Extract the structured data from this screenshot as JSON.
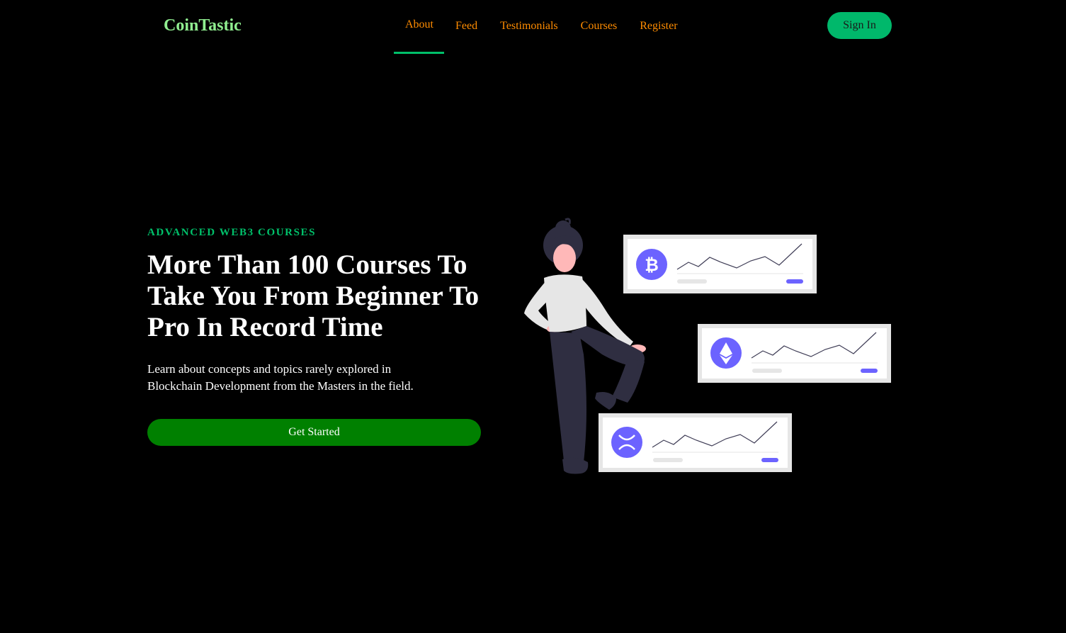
{
  "header": {
    "brand": "CoinTastic",
    "nav": [
      {
        "label": "About",
        "active": true
      },
      {
        "label": "Feed",
        "active": false
      },
      {
        "label": "Testimonials",
        "active": false
      },
      {
        "label": "Courses",
        "active": false
      },
      {
        "label": "Register",
        "active": false
      }
    ],
    "sign_in_label": "Sign In"
  },
  "hero": {
    "eyebrow": "ADVANCED WEB3 COURSES",
    "headline": "More Than 100 Courses To Take You From Beginner To Pro In Record Time",
    "description": "Learn about concepts and topics rarely explored in Blockchain Development from the Masters in the field.",
    "cta_label": "Get Started"
  },
  "illustration": {
    "cards": [
      {
        "icon": "bitcoin-icon"
      },
      {
        "icon": "ethereum-icon"
      },
      {
        "icon": "xrp-icon"
      }
    ]
  },
  "colors": {
    "background": "#000000",
    "brand": "#90ee90",
    "nav_link": "#ff8c00",
    "accent": "#00c06a",
    "cta": "#008000",
    "illustration_accent": "#6c63ff"
  }
}
